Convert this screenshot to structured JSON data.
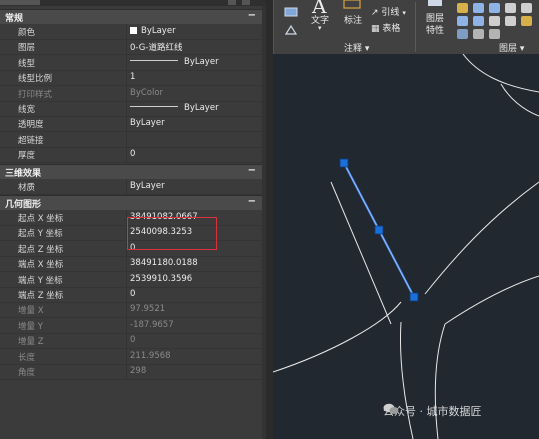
{
  "palette": {
    "sections": {
      "general": {
        "title": "常规",
        "toggle": "−"
      },
      "three_d": {
        "title": "三维效果",
        "toggle": "−"
      },
      "geometry": {
        "title": "几何图形",
        "toggle": "−"
      }
    },
    "general_rows": [
      {
        "label": "颜色",
        "value": "ByLayer",
        "kind": "swatch"
      },
      {
        "label": "图层",
        "value": "0-G-道路红线"
      },
      {
        "label": "线型",
        "value": "ByLayer",
        "kind": "line"
      },
      {
        "label": "线型比例",
        "value": "1"
      },
      {
        "label": "打印样式",
        "value": "ByColor",
        "dim": true
      },
      {
        "label": "线宽",
        "value": "ByLayer",
        "kind": "line"
      },
      {
        "label": "透明度",
        "value": "ByLayer"
      },
      {
        "label": "超链接",
        "value": ""
      },
      {
        "label": "厚度",
        "value": "0"
      }
    ],
    "three_d_rows": [
      {
        "label": "材质",
        "value": "ByLayer"
      }
    ],
    "geometry_rows": [
      {
        "label": "起点 X 坐标",
        "value": "38491082.0667"
      },
      {
        "label": "起点 Y 坐标",
        "value": "2540098.3253"
      },
      {
        "label": "起点 Z 坐标",
        "value": "0"
      },
      {
        "label": "端点 X 坐标",
        "value": "38491180.0188"
      },
      {
        "label": "端点 Y 坐标",
        "value": "2539910.3596"
      },
      {
        "label": "端点 Z 坐标",
        "value": "0"
      },
      {
        "label": "增量 X",
        "value": "97.9521",
        "dim": true
      },
      {
        "label": "增量 Y",
        "value": "-187.9657",
        "dim": true
      },
      {
        "label": "增量 Z",
        "value": "0",
        "dim": true
      },
      {
        "label": "长度",
        "value": "211.9568",
        "dim": true
      },
      {
        "label": "角度",
        "value": "298",
        "dim": true
      }
    ]
  },
  "ribbon": {
    "text_tool": "文字",
    "dim_tool": "标注",
    "leader_tool": "引线",
    "table_tool": "表格",
    "layer_props_line1": "图层",
    "layer_props_line2": "特性",
    "annotation_group": "注释 ▾",
    "layers_group": "图层 ▾"
  },
  "watermark": {
    "text": "公众号 · 城市数据匠"
  },
  "colors": {
    "canvas_bg": "#212830",
    "selected_line": "#4a86e8",
    "grip": "#1565c0",
    "highlight_box": "#d9323e"
  }
}
